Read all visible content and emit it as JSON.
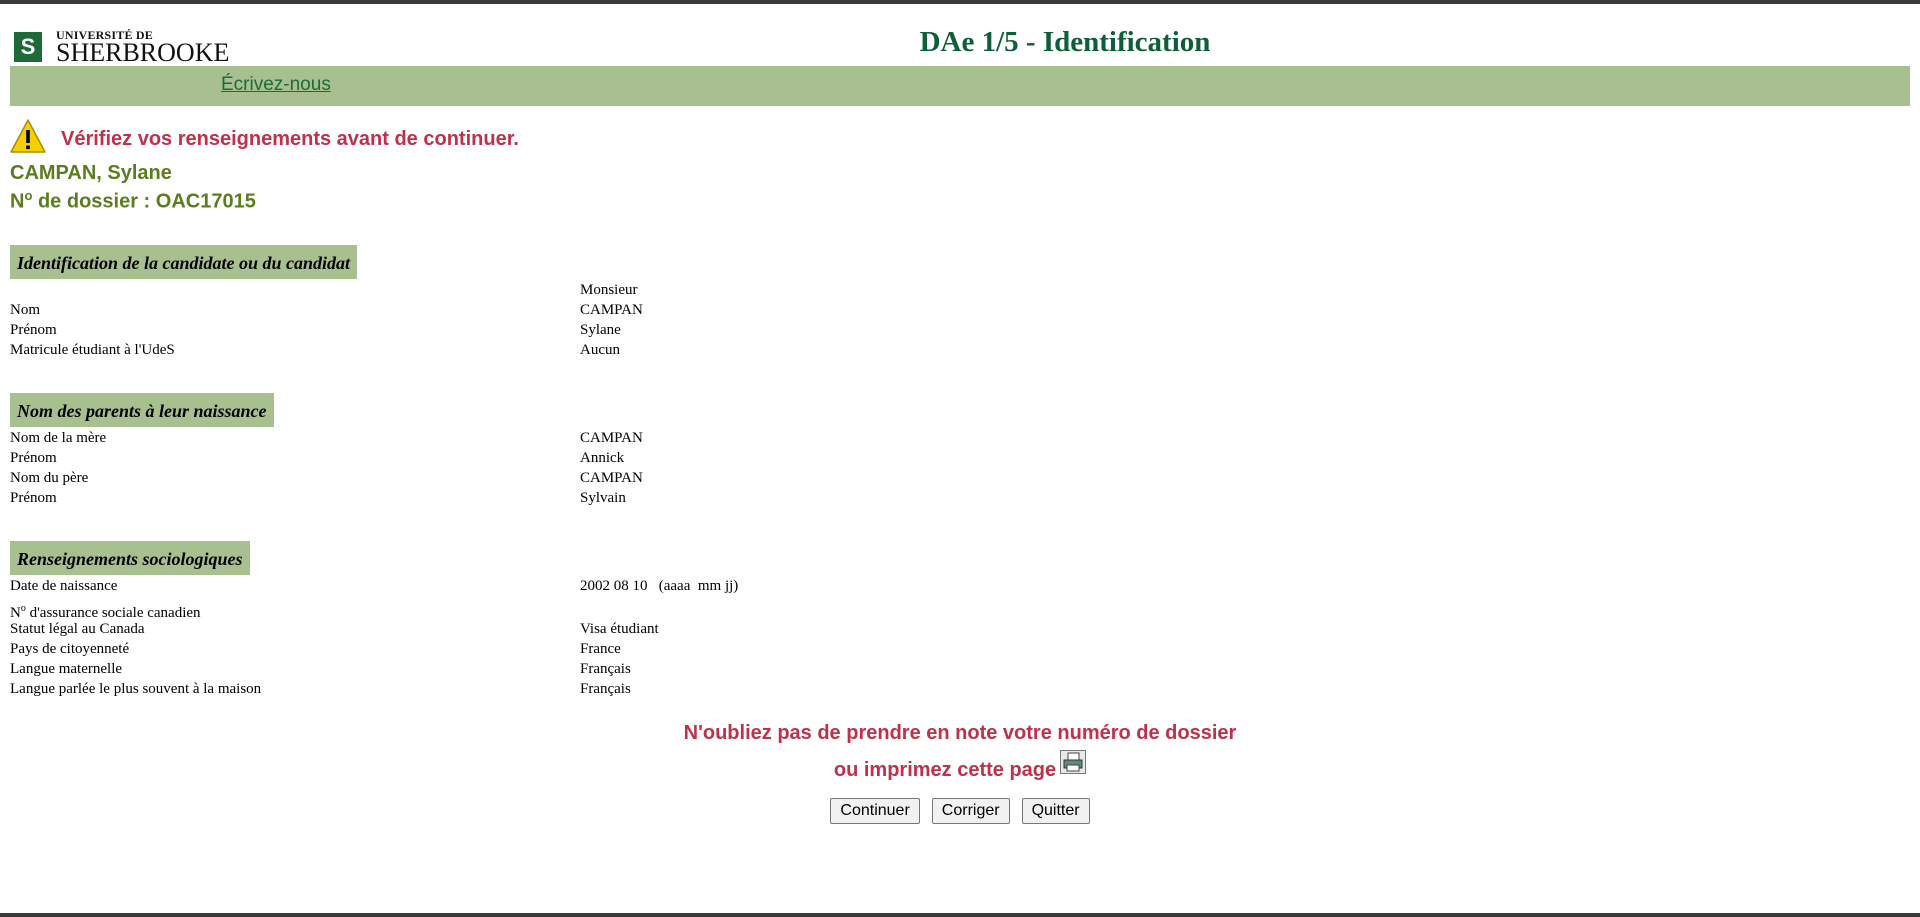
{
  "header": {
    "logo_top": "UNIVERSITÉ DE",
    "logo_bottom": "SHERBROOKE",
    "title": "DAe 1/5 - Identification"
  },
  "nav": {
    "link": "Écrivez-nous"
  },
  "alert": {
    "icon": "warning-icon",
    "message": "Vérifiez vos renseignements avant de continuer."
  },
  "candidate": {
    "name": "CAMPAN, Sylane",
    "dossier_prefix": "N",
    "dossier_sup": "o",
    "dossier_text": " de dossier : OAC17015"
  },
  "identification": {
    "heading": "Identification de la candidate ou du candidat",
    "rows": [
      {
        "label": "",
        "value": "Monsieur"
      },
      {
        "label": "Nom",
        "value": "CAMPAN"
      },
      {
        "label": "Prénom",
        "value": "Sylane"
      },
      {
        "label": "Matricule étudiant à l'UdeS",
        "value": "Aucun"
      }
    ]
  },
  "parents": {
    "heading": "Nom des parents à leur naissance",
    "rows": [
      {
        "label": "Nom de la mère",
        "value": "CAMPAN"
      },
      {
        "label": "Prénom",
        "value": "Annick"
      },
      {
        "label": "Nom du père",
        "value": "CAMPAN"
      },
      {
        "label": "Prénom",
        "value": "Sylvain"
      }
    ]
  },
  "socio": {
    "heading": "Renseignements sociologiques",
    "rows": [
      {
        "label": "Date de naissance",
        "value": "2002 08 10   (aaaa  mm jj)"
      },
      {
        "label_prefix": "N",
        "label_sup": "o",
        "label": " d'assurance sociale canadien",
        "value": ""
      },
      {
        "label": "Statut légal au Canada",
        "value": "Visa étudiant"
      },
      {
        "label": "Pays de citoyenneté",
        "value": "France"
      },
      {
        "label": "Langue maternelle",
        "value": "Français"
      },
      {
        "label": "Langue parlée le plus souvent à la maison",
        "value": "Français"
      }
    ]
  },
  "reminder": {
    "line1": "N'oubliez pas de prendre en note votre numéro de dossier",
    "line2": "ou imprimez cette page",
    "print_icon": "printer-icon"
  },
  "buttons": {
    "continue": "Continuer",
    "correct": "Corriger",
    "quit": "Quitter"
  },
  "colors": {
    "brand_green": "#0d5f37",
    "band_green": "#a8bf90",
    "alert_red": "#c0304a",
    "olive": "#5a7d1e"
  }
}
